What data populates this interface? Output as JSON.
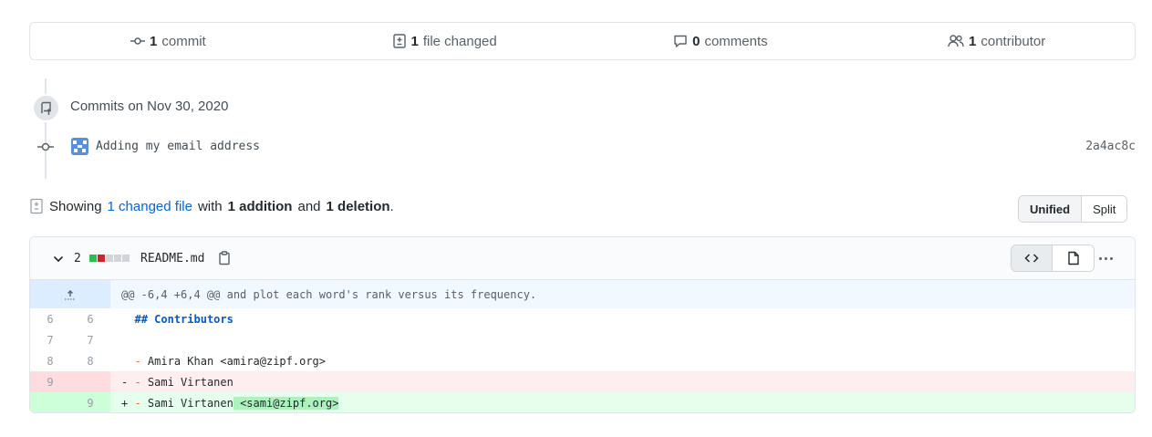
{
  "summary": {
    "commits_count": "1",
    "commits_label": "commit",
    "files_count": "1",
    "files_label": "file changed",
    "comments_count": "0",
    "comments_label": "comments",
    "contributors_count": "1",
    "contributors_label": "contributor"
  },
  "timeline": {
    "date_heading": "Commits on Nov 30, 2020",
    "commit_message": "Adding my email address",
    "commit_sha": "2a4ac8c"
  },
  "showing": {
    "prefix": "Showing",
    "changed_link": "1 changed file",
    "with": "with",
    "additions": "1 addition",
    "and": "and",
    "deletions": "1 deletion",
    "period": "."
  },
  "view_toggle": {
    "unified": "Unified",
    "split": "Split"
  },
  "file": {
    "diffstat": "2",
    "name": "README.md",
    "hunk_header": "@@ -6,4 +6,4 @@ and plot each word's rank versus its frequency.",
    "lines": [
      {
        "old": "6",
        "new": "6",
        "marker": " ",
        "text": "## Contributors"
      },
      {
        "old": "7",
        "new": "7",
        "marker": " ",
        "text": ""
      },
      {
        "old": "8",
        "new": "8",
        "marker": " ",
        "text": "- Amira Khan <amira@zipf.org>"
      },
      {
        "old": "9",
        "new": "",
        "marker": "-",
        "text": "- Sami Virtanen"
      },
      {
        "old": "",
        "new": "9",
        "marker": "+",
        "text": "- Sami Virtanen",
        "added_highlight": " <sami@zipf.org>"
      }
    ]
  },
  "colors": {
    "add_block": "#2cbe4e",
    "del_block": "#cb2431",
    "neutral_block": "#d1d5da",
    "link": "#0366d6"
  }
}
